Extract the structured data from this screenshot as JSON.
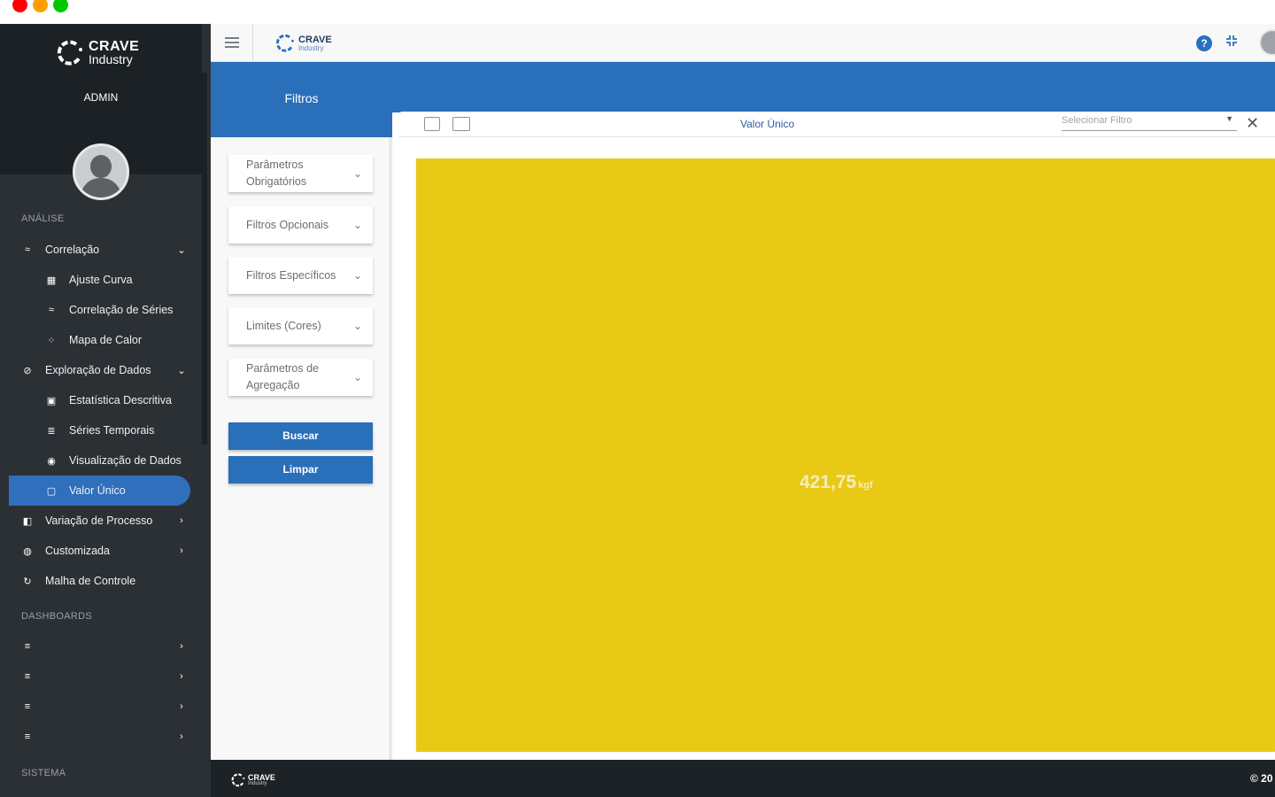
{
  "sidebar": {
    "brand_line1": "CRAVE",
    "brand_line2": "Industry",
    "role": "ADMIN",
    "sections": {
      "analysis": "ANÁLISE",
      "dashboards": "DASHBOARDS",
      "system": "SISTEMA"
    },
    "items": {
      "correlacao": "Correlação",
      "ajuste_curva": "Ajuste Curva",
      "correlacao_series": "Correlação de Séries",
      "mapa_calor": "Mapa de Calor",
      "exploracao": "Exploração de Dados",
      "estatistica": "Estatística Descritiva",
      "series_temporais": "Séries Temporais",
      "visualizacao": "Visualização de Dados",
      "valor_unico": "Valor Único",
      "variacao": "Variação de Processo",
      "customizada": "Customizada",
      "malha": "Malha de Controle"
    }
  },
  "topbar": {
    "logo_line1": "CRAVE",
    "logo_line2": "Industry",
    "help_glyph": "?"
  },
  "filters": {
    "title": "Filtros",
    "accordions": {
      "obrigatorios": "Parâmetros Obrigatórios",
      "opcionais": "Filtros Opcionais",
      "especificos": "Filtros Específicos",
      "limites": "Limites (Cores)",
      "agregacao": "Parâmetros de Agregação"
    },
    "search_label": "Buscar",
    "clear_label": "Limpar"
  },
  "content": {
    "title": "Valor Único",
    "filter_select_placeholder": "Selecionar Filtro",
    "value": "421,75",
    "unit": "kgf",
    "tile_color": "#e8c915"
  },
  "footer": {
    "logo_line1": "CRAVE",
    "logo_line2": "Industry",
    "copyright": "© 20"
  },
  "colors": {
    "primary": "#2a6fb9",
    "sidebar_bg": "#2b3035",
    "active_item": "#2f6fbc"
  }
}
